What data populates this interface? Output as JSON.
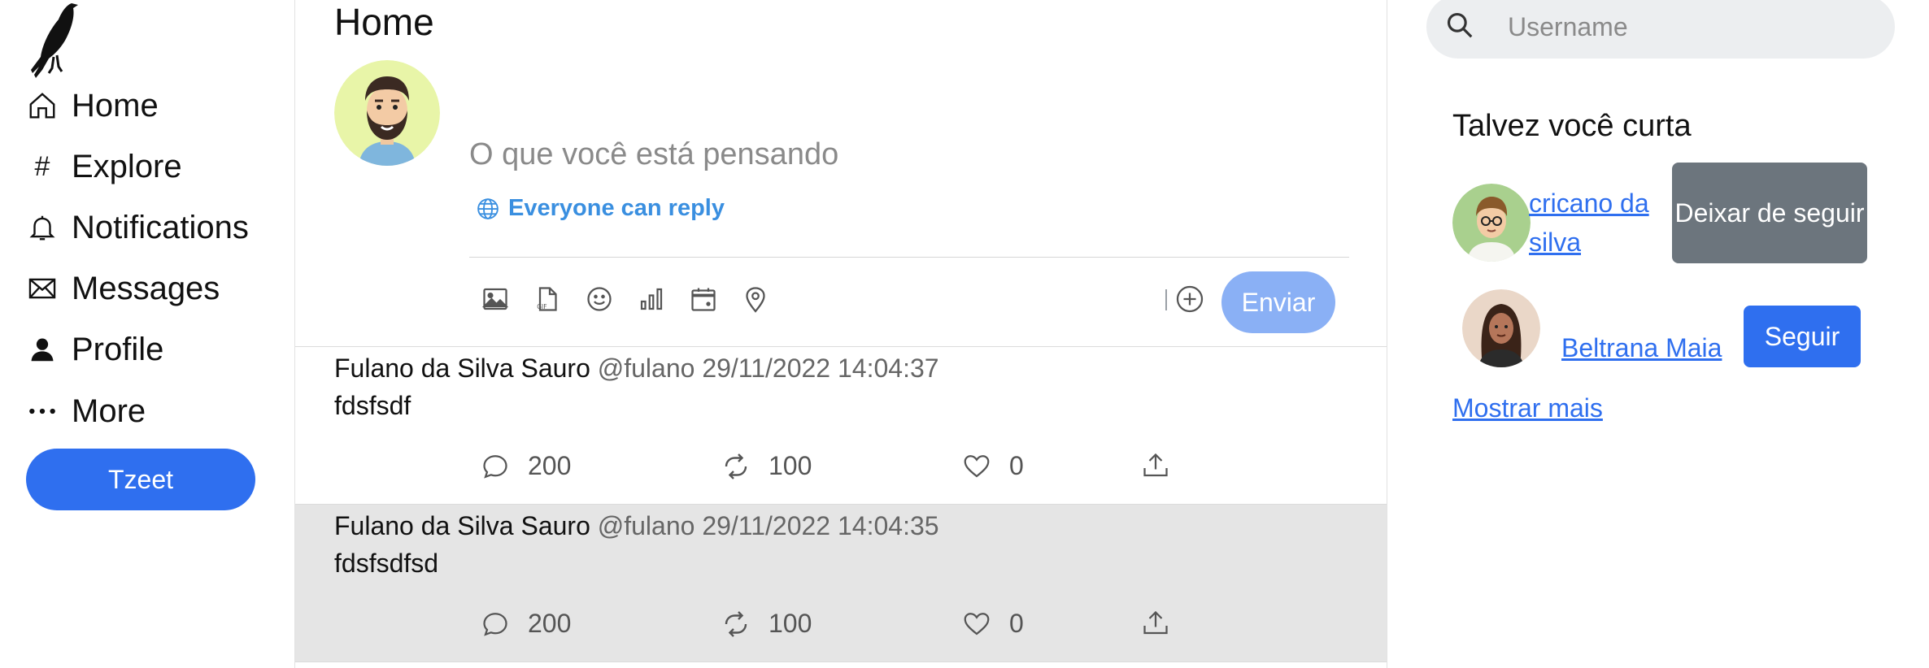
{
  "nav": {
    "logo": "crow-logo",
    "items": [
      {
        "label": "Home",
        "icon": "home-icon"
      },
      {
        "label": "Explore",
        "icon": "hashtag-icon"
      },
      {
        "label": "Notifications",
        "icon": "bell-icon"
      },
      {
        "label": "Messages",
        "icon": "envelope-icon"
      },
      {
        "label": "Profile",
        "icon": "person-icon"
      },
      {
        "label": "More",
        "icon": "dots-icon"
      }
    ],
    "tweet_button": "Tzeet"
  },
  "main": {
    "title": "Home",
    "composer": {
      "placeholder": "O que você está pensando",
      "reply_setting": "Everyone can reply",
      "toolbar_icons": [
        "image-icon",
        "gif-icon",
        "emoji-icon",
        "poll-icon",
        "schedule-icon",
        "location-icon"
      ],
      "send_label": "Enviar"
    },
    "posts": [
      {
        "author": "Fulano da Silva Sauro",
        "handle": "@fulano",
        "timestamp": "29/11/2022 14:04:37",
        "text": "fdsfsdf",
        "replies": "200",
        "retweets": "100",
        "likes": "0"
      },
      {
        "author": "Fulano da Silva Sauro",
        "handle": "@fulano",
        "timestamp": "29/11/2022 14:04:35",
        "text": "fdsfsdfsd",
        "replies": "200",
        "retweets": "100",
        "likes": "0"
      }
    ]
  },
  "right": {
    "search_placeholder": "Username",
    "suggestions_title": "Talvez você curta",
    "suggestions": [
      {
        "name": "cricano da silva",
        "button": "Deixar de seguir"
      },
      {
        "name": "Beltrana Maia",
        "button": "Seguir"
      }
    ],
    "show_more": "Mostrar mais"
  },
  "colors": {
    "accent": "#2f6fef",
    "send_disabled": "#8ab0f5",
    "unfollow_gray": "#6c757d",
    "reply_blue": "#3a8fe0"
  }
}
